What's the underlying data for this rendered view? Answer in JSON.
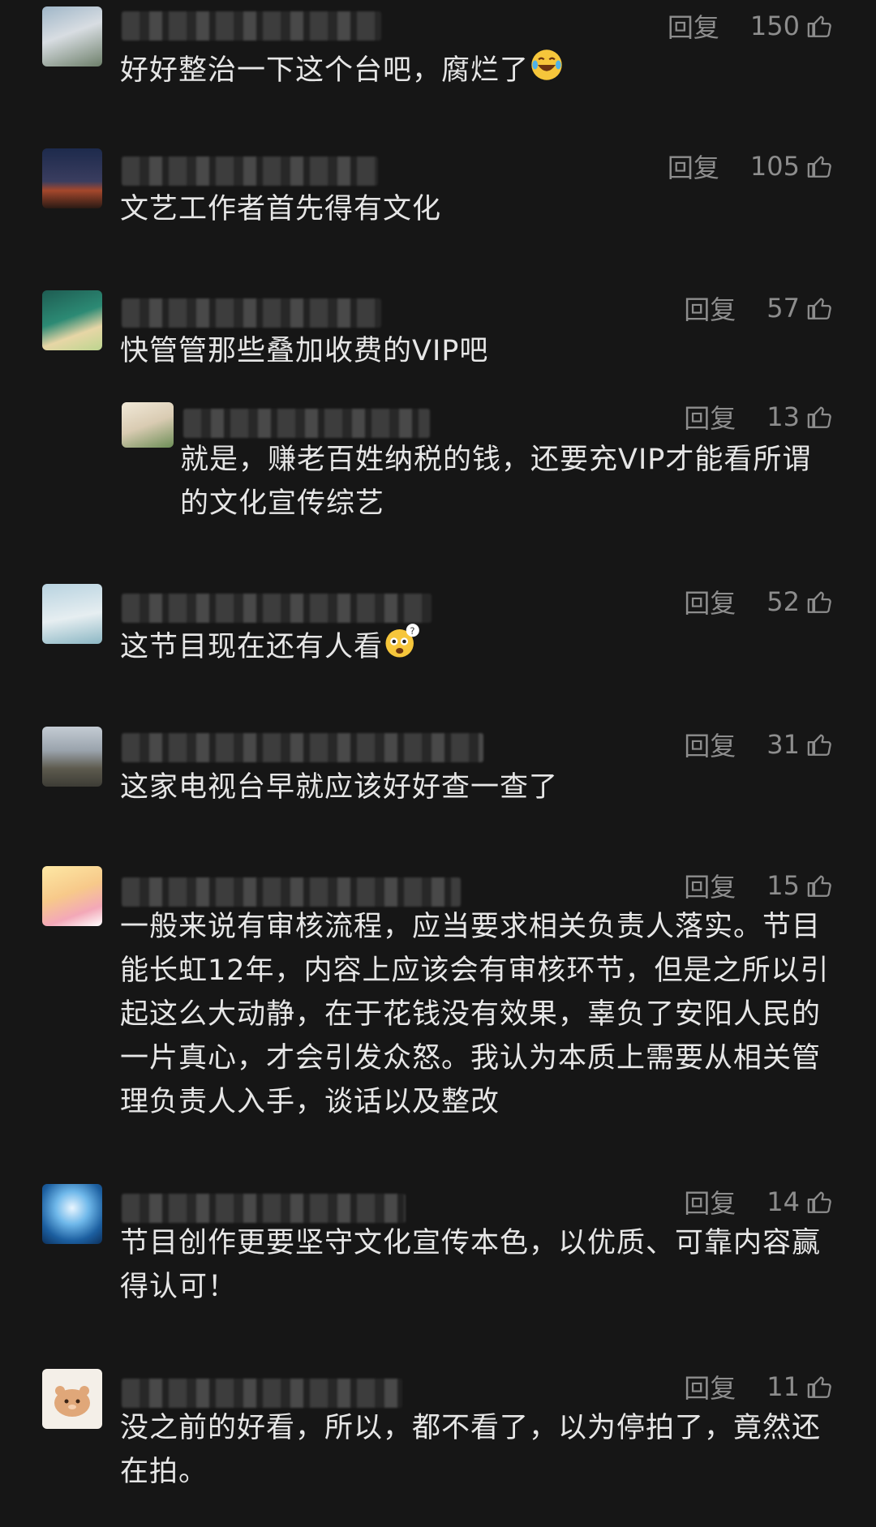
{
  "ui": {
    "reply_label": "回复"
  },
  "comments": [
    {
      "text": "好好整治一下这个台吧，腐烂了",
      "likes": "150",
      "emoji": "laughing-tears"
    },
    {
      "text": "文艺工作者首先得有文化",
      "likes": "105"
    },
    {
      "text": "快管管那些叠加收费的VIP吧",
      "likes": "57"
    },
    {
      "text": "就是，赚老百姓纳税的钱，还要充VIP才能看所谓的文化宣传综艺",
      "likes": "13",
      "reply": true
    },
    {
      "text": "这节目现在还有人看",
      "likes": "52",
      "emoji": "confused-face"
    },
    {
      "text": "这家电视台早就应该好好查一查了",
      "likes": "31"
    },
    {
      "text": "一般来说有审核流程，应当要求相关负责人落实。节目能长虹12年，内容上应该会有审核环节，但是之所以引起这么大动静，在于花钱没有效果，辜负了安阳人民的一片真心，才会引发众怒。我认为本质上需要从相关管理负责人入手，谈话以及整改",
      "likes": "15"
    },
    {
      "text": "节目创作更要坚守文化宣传本色，以优质、可靠内容赢得认可！",
      "likes": "14"
    },
    {
      "text": "没之前的好看，所以，都不看了，以为停拍了，竟然还在拍。",
      "likes": "11"
    }
  ]
}
